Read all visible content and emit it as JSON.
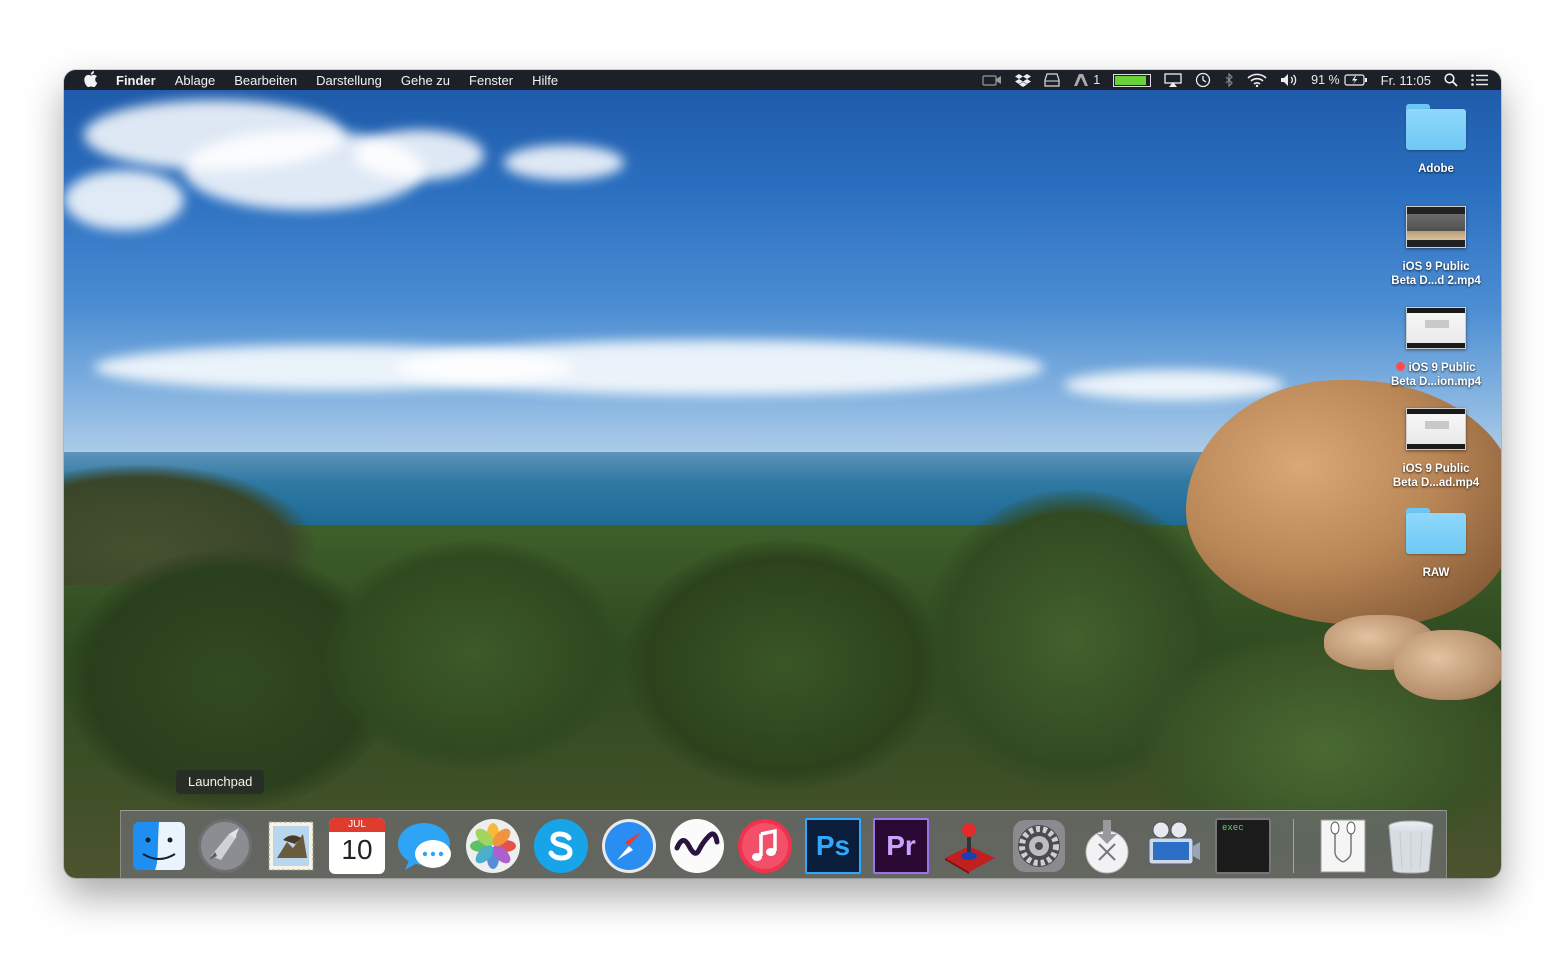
{
  "menubar": {
    "app_name": "Finder",
    "items": [
      "Ablage",
      "Bearbeiten",
      "Darstellung",
      "Gehe zu",
      "Fenster",
      "Hilfe"
    ],
    "status": {
      "notification_count": "1",
      "battery_percent_label": "91 %",
      "battery_level": 0.91,
      "clock": "Fr. 11:05"
    }
  },
  "desktop": {
    "icons": [
      {
        "type": "folder",
        "label": "Adobe"
      },
      {
        "type": "video",
        "line1": "iOS 9 Public",
        "line2": "Beta D...d 2.mp4"
      },
      {
        "type": "doc",
        "line1": "iOS 9 Public",
        "line2": "Beta D...ion.mp4",
        "tag": "red"
      },
      {
        "type": "doc",
        "line1": "iOS 9 Public",
        "line2": "Beta D...ad.mp4"
      },
      {
        "type": "folder",
        "label": "RAW"
      }
    ]
  },
  "tooltip": {
    "text": "Launchpad"
  },
  "dock": {
    "calendar": {
      "month": "JUL",
      "day": "10"
    },
    "ps_label": "Ps",
    "pr_label": "Pr",
    "terminal_text": "exec",
    "items": [
      {
        "name": "finder-icon",
        "running": true
      },
      {
        "name": "launchpad-icon",
        "running": false
      },
      {
        "name": "mail-icon",
        "running": false
      },
      {
        "name": "calendar-icon",
        "running": false
      },
      {
        "name": "messages-icon",
        "running": true
      },
      {
        "name": "photos-icon",
        "running": false
      },
      {
        "name": "skype-icon",
        "running": false
      },
      {
        "name": "safari-icon",
        "running": true
      },
      {
        "name": "cinema-app-icon",
        "running": false
      },
      {
        "name": "itunes-icon",
        "running": false
      },
      {
        "name": "photoshop-icon",
        "running": false
      },
      {
        "name": "premiere-icon",
        "running": false
      },
      {
        "name": "joystick-app-icon",
        "running": false
      },
      {
        "name": "system-preferences-icon",
        "running": false
      },
      {
        "name": "osx-installer-icon",
        "running": true
      },
      {
        "name": "movie-app-icon",
        "running": true
      },
      {
        "name": "terminal-icon",
        "running": true
      },
      {
        "name": "earphones-document-icon",
        "running": false
      },
      {
        "name": "trash-icon",
        "running": false
      }
    ]
  },
  "colors": {
    "menubar_bg": "#1c1c1e",
    "folder_blue": "#6ec8f4",
    "battery_green": "#6bd13b",
    "tag_red": "#ff4b4b"
  }
}
